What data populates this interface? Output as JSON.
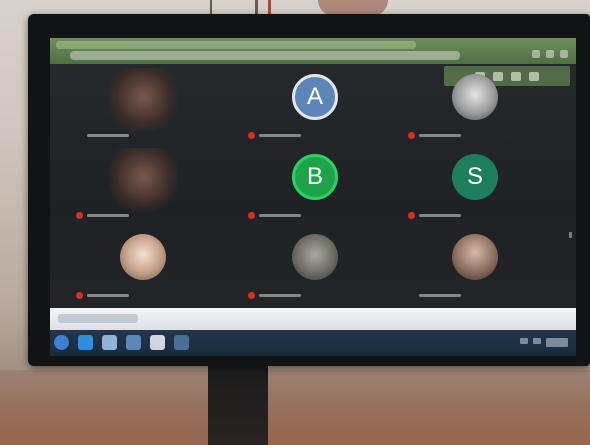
{
  "browser": {
    "tab_title": "",
    "url": ""
  },
  "meeting": {
    "participants": [
      {
        "name": "",
        "avatar_letter": "",
        "avatar_kind": "video",
        "mic_muted": false
      },
      {
        "name": "",
        "avatar_letter": "A",
        "avatar_kind": "letter",
        "avatar_color": "#5d86b8",
        "mic_muted": true
      },
      {
        "name": "",
        "avatar_letter": "",
        "avatar_kind": "photo",
        "mic_muted": true
      },
      {
        "name": "",
        "avatar_letter": "",
        "avatar_kind": "video",
        "mic_muted": true
      },
      {
        "name": "",
        "avatar_letter": "B",
        "avatar_kind": "letter",
        "avatar_color": "#1ea34a",
        "mic_muted": true
      },
      {
        "name": "",
        "avatar_letter": "S",
        "avatar_kind": "letter",
        "avatar_color": "#1f7f5c",
        "mic_muted": true
      },
      {
        "name": "",
        "avatar_letter": "",
        "avatar_kind": "photo",
        "mic_muted": true
      },
      {
        "name": "",
        "avatar_letter": "",
        "avatar_kind": "photo",
        "mic_muted": true
      },
      {
        "name": "",
        "avatar_letter": "",
        "avatar_kind": "photo",
        "mic_muted": false
      }
    ]
  },
  "taskbar": {
    "search_placeholder": "",
    "clock": "",
    "icons": [
      "windows-start-icon",
      "edge-browser-icon",
      "file-explorer-icon",
      "mail-icon",
      "store-icon",
      "media-icon"
    ]
  },
  "colors": {
    "browser_bar": "#4f6e45",
    "meet_background": "#1f2225",
    "muted_indicator": "#d93025",
    "taskbar": "#1a2a3c"
  }
}
